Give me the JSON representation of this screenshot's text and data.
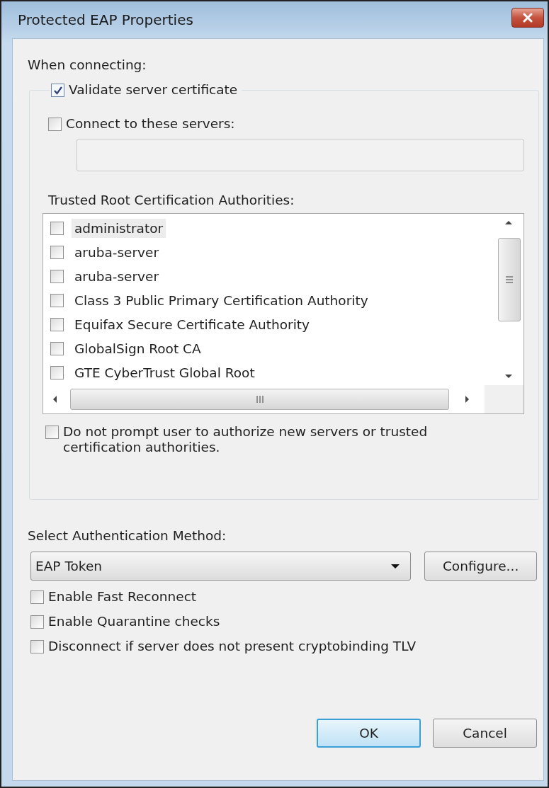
{
  "window": {
    "title": "Protected EAP Properties"
  },
  "when_connecting_label": "When connecting:",
  "validate_server_certificate": {
    "label": "Validate server certificate",
    "checked": true
  },
  "connect_to_servers": {
    "label": "Connect to these servers:",
    "checked": false
  },
  "trusted_roots": {
    "label": "Trusted Root Certification Authorities:",
    "items": [
      {
        "name": "administrator",
        "checked": false,
        "selected": true
      },
      {
        "name": "aruba-server",
        "checked": false,
        "selected": false
      },
      {
        "name": "aruba-server",
        "checked": false,
        "selected": false
      },
      {
        "name": "Class 3 Public Primary Certification Authority",
        "checked": false,
        "selected": false
      },
      {
        "name": "Equifax Secure Certificate Authority",
        "checked": false,
        "selected": false
      },
      {
        "name": "GlobalSign Root CA",
        "checked": false,
        "selected": false
      },
      {
        "name": "GTE CyberTrust Global Root",
        "checked": false,
        "selected": false
      }
    ]
  },
  "do_not_prompt": {
    "label": "Do not prompt user to authorize new servers or trusted certification authorities.",
    "checked": false
  },
  "auth_method": {
    "label": "Select Authentication Method:",
    "value": "EAP Token"
  },
  "configure_button": "Configure...",
  "options": [
    {
      "label": "Enable Fast Reconnect",
      "checked": false
    },
    {
      "label": "Enable Quarantine checks",
      "checked": false
    },
    {
      "label": "Disconnect if server does not present cryptobinding TLV",
      "checked": false
    }
  ],
  "buttons": [
    {
      "label": "OK",
      "default": true
    },
    {
      "label": "Cancel",
      "default": false
    }
  ]
}
